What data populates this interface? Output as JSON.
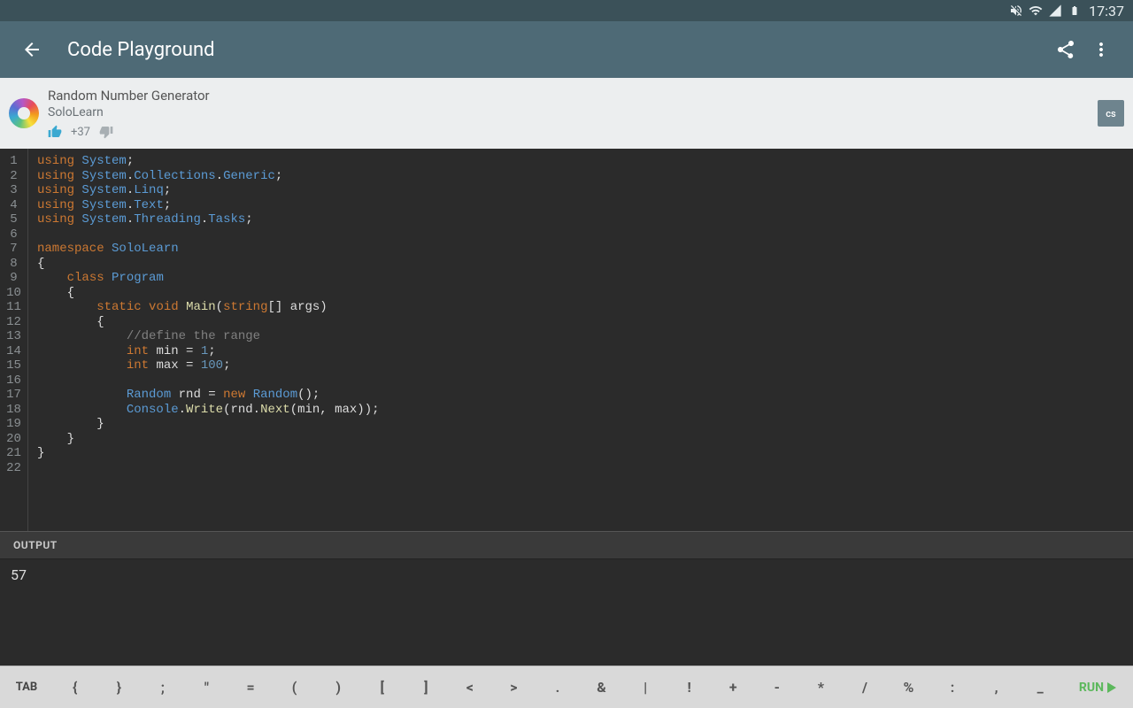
{
  "statusbar": {
    "time": "17:37"
  },
  "appbar": {
    "title": "Code Playground"
  },
  "meta": {
    "title": "Random Number Generator",
    "author": "SoloLearn",
    "votes": "+37",
    "lang_badge": "cs"
  },
  "editor": {
    "lines": 22
  },
  "output": {
    "label": "OUTPUT",
    "value": "57"
  },
  "toolbar": {
    "tab": "TAB",
    "symbols": [
      "{",
      "}",
      ";",
      "\"",
      "=",
      "(",
      ")",
      "[",
      "]",
      "<",
      ">",
      ".",
      "&",
      "|",
      "!",
      "+",
      "-",
      "*",
      "/",
      "%",
      ":",
      ",",
      "_"
    ],
    "run": "RUN"
  }
}
